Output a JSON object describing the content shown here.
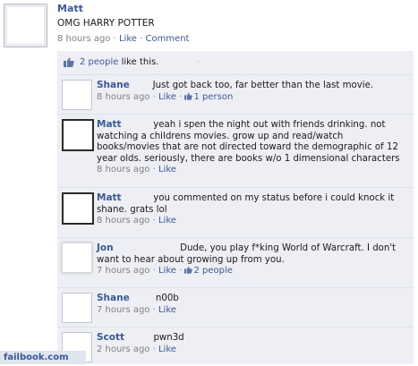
{
  "post": {
    "author": "Matt",
    "text": "OMG HARRY POTTER",
    "time": "8 hours ago",
    "like": "Like",
    "comment": "Comment",
    "sep": " · "
  },
  "likes": {
    "people": "2 people",
    "suffix": " like this.",
    "dot": "·"
  },
  "comments": [
    {
      "author": "Shane",
      "pad": "        ",
      "text": "Just got back too, far better than the last movie.",
      "time": "8 hours ago",
      "like": "Like",
      "likes_count": "1 person"
    },
    {
      "author": "Matt",
      "pad": "           ",
      "text": "yeah i spen the night out with friends drinking. not watching a childrens movies. grow up and read/watch books/movies that are not directed toward the demographic of 12 year olds. seriously, there are books w/o 1 dimensional characters",
      "time": "8 hours ago",
      "like": "Like"
    },
    {
      "author": "Matt",
      "pad": "           ",
      "text": "you commented on my status before i could knock it shane. grats lol",
      "time": "8 hours ago",
      "like": "Like"
    },
    {
      "author": "Jon",
      "pad": "                       ",
      "text": "Dude, you play f*king World of Warcraft. I don't want to hear about growing up from you.",
      "time": "7 hours ago",
      "like": "Like",
      "likes_count": "2 people"
    },
    {
      "author": "Shane",
      "pad": "         ",
      "text": "n00b",
      "time": "7 hours ago",
      "like": "Like"
    },
    {
      "author": "Scott",
      "pad": "          ",
      "text": "pwn3d",
      "time": "2 hours ago",
      "like": "Like"
    }
  ],
  "watermark": "failbook.com",
  "colors": {
    "link": "#3b5998",
    "thread_bg": "#edeff4",
    "meta": "#808080"
  }
}
